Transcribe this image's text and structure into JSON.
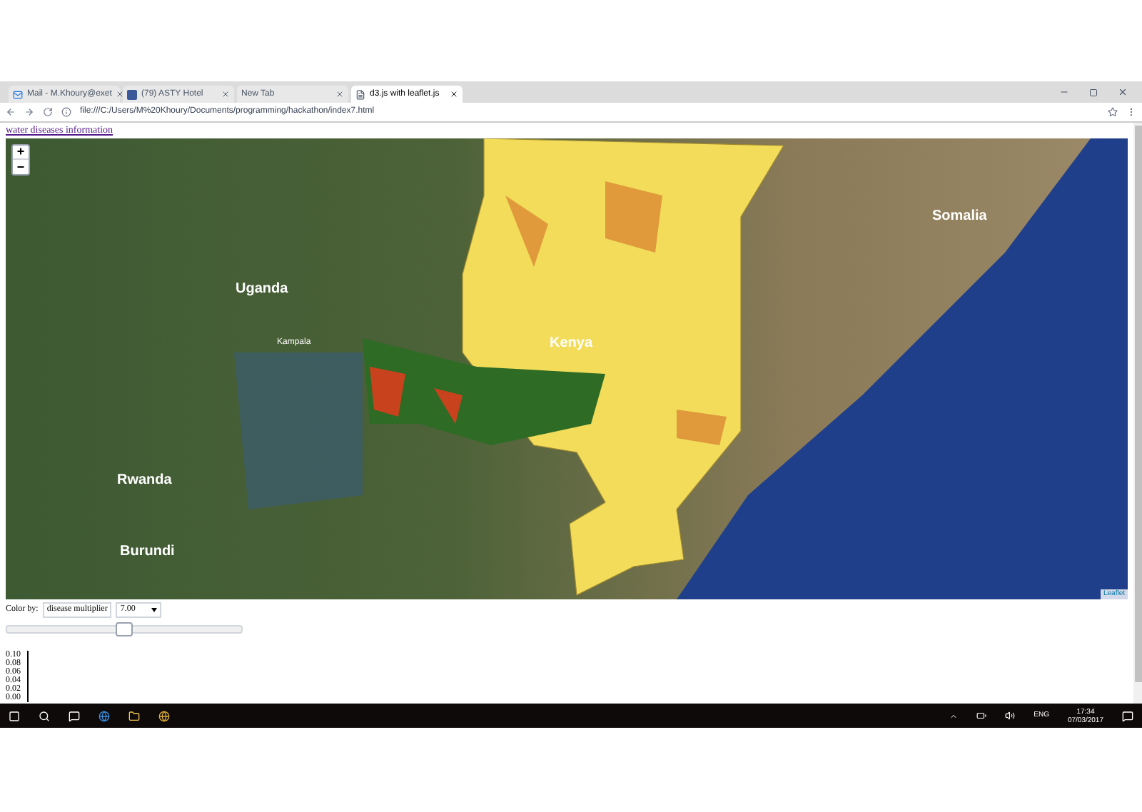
{
  "browser": {
    "tabs": [
      {
        "title": "Mail - M.Khoury@exet",
        "selected": false,
        "kind": "mail"
      },
      {
        "title": "(79) ASTY Hotel",
        "selected": false,
        "kind": "social"
      },
      {
        "title": "New Tab",
        "selected": false,
        "kind": "blank"
      },
      {
        "title": "d3.js with leaflet.js",
        "selected": true,
        "kind": "page"
      }
    ],
    "address": "file:///C:/Users/M%20Khoury/Documents/programming/hackathon/index7.html"
  },
  "page": {
    "link": "water diseases information",
    "map": {
      "zoom_in": "+",
      "zoom_out": "−",
      "attribution": "Leaflet",
      "labels": [
        {
          "text": "Uganda",
          "kind": "country"
        },
        {
          "text": "Kenya",
          "kind": "country"
        },
        {
          "text": "Somalia",
          "kind": "country"
        },
        {
          "text": "Rwanda",
          "kind": "country"
        },
        {
          "text": "Burundi",
          "kind": "country"
        },
        {
          "text": "Kampala",
          "kind": "city"
        }
      ]
    },
    "controls": {
      "label": "Color by:",
      "select": "disease multiplier",
      "value": "7.00",
      "slider": {
        "level": 0.5
      }
    },
    "axis_ticks": [
      "0.10",
      "0.08",
      "0.06",
      "0.04",
      "0.02",
      "0.00"
    ]
  },
  "taskbar": {
    "language": "ENG",
    "time": "17:34",
    "date": "07/03/2017"
  }
}
